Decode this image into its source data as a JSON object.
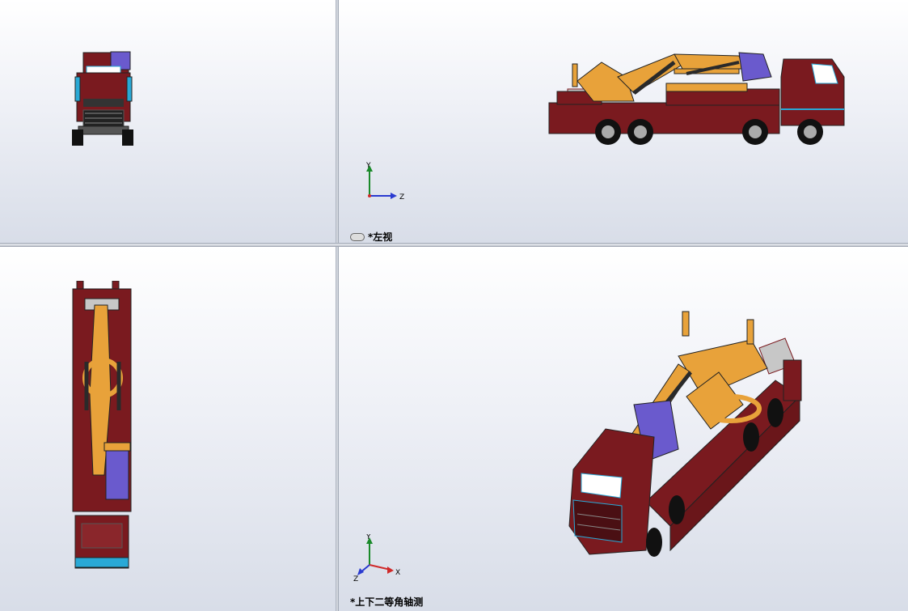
{
  "viewports": {
    "front": {
      "name": "front-view"
    },
    "left": {
      "label": "*左视",
      "axes": {
        "y": "Y",
        "z": "Z"
      }
    },
    "top": {
      "name": "top-view"
    },
    "iso": {
      "label": "*上下二等角轴测",
      "axes": {
        "y": "Y",
        "x": "X",
        "z": "Z"
      }
    }
  },
  "colors": {
    "body_red": "#7a1a1f",
    "boom_orange": "#e8a23a",
    "cylinder_dark": "#2a2a2a",
    "accent_blue": "#6a5acd",
    "edge_cyan": "#29a9d6"
  }
}
